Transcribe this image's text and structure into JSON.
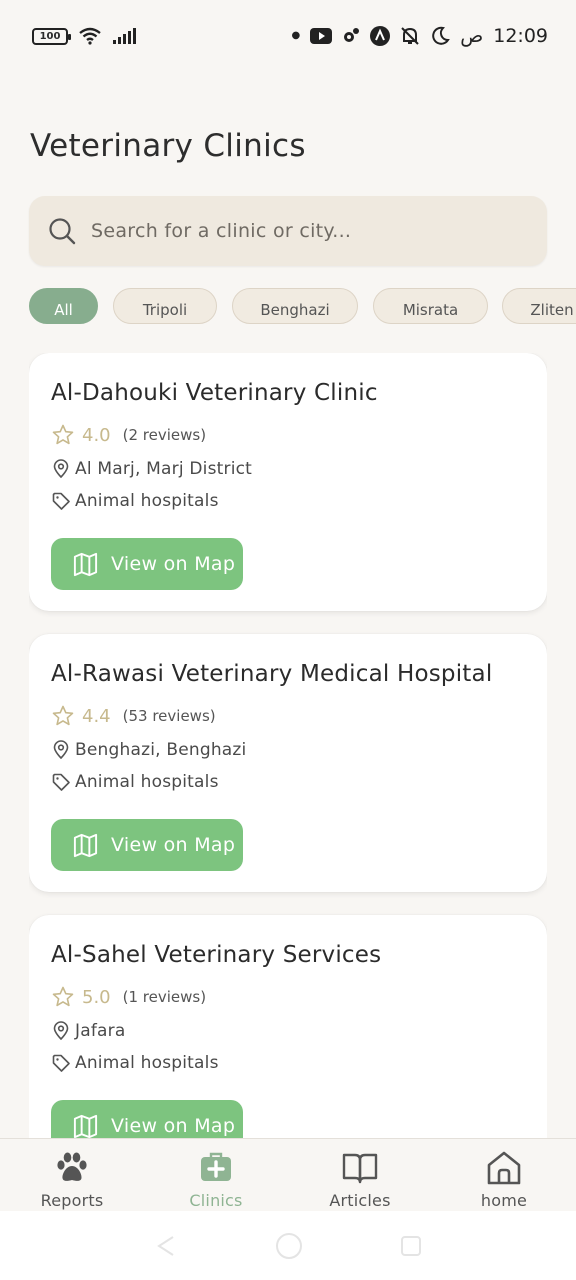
{
  "status_bar": {
    "battery": "100",
    "time": "12:09",
    "am_pm": "ص",
    "icons": [
      "wifi-icon",
      "signal-icon",
      "dot-icon",
      "youtube-icon",
      "settings-icon",
      "a-icon",
      "bell-off-icon",
      "moon-icon"
    ]
  },
  "header": {
    "title": "Veterinary Clinics"
  },
  "search": {
    "placeholder": "Search for a clinic or city..."
  },
  "filters": [
    {
      "label": "All",
      "active": true
    },
    {
      "label": "Tripoli",
      "active": false
    },
    {
      "label": "Benghazi",
      "active": false
    },
    {
      "label": "Misrata",
      "active": false
    },
    {
      "label": "Zliten",
      "active": false
    }
  ],
  "clinics": [
    {
      "name": "Al-Dahouki Veterinary Clinic",
      "rating": "4.0",
      "reviews": "(2 reviews)",
      "location": "Al Marj, Marj District",
      "category": "Animal hospitals",
      "button": "View on Map"
    },
    {
      "name": "Al-Rawasi Veterinary Medical Hospital",
      "rating": "4.4",
      "reviews": "(53 reviews)",
      "location": "Benghazi, Benghazi",
      "category": "Animal hospitals",
      "button": "View on Map"
    },
    {
      "name": "Al-Sahel Veterinary Services",
      "rating": "5.0",
      "reviews": "(1 reviews)",
      "location": "Jafara",
      "category": "Animal hospitals",
      "button": "View on Map"
    }
  ],
  "bottom_nav": [
    {
      "label": "Reports",
      "icon": "paw-icon",
      "active": false
    },
    {
      "label": "Clinics",
      "icon": "medical-kit-icon",
      "active": true
    },
    {
      "label": "Articles",
      "icon": "book-icon",
      "active": false
    },
    {
      "label": "home",
      "icon": "home-icon",
      "active": false
    }
  ],
  "colors": {
    "accent": "#7dc47f",
    "chip_active": "#87ad8e",
    "nav_active": "#8fb493",
    "star": "#c7b98d",
    "search_bg": "#efe9df",
    "background": "#f8f6f3"
  }
}
